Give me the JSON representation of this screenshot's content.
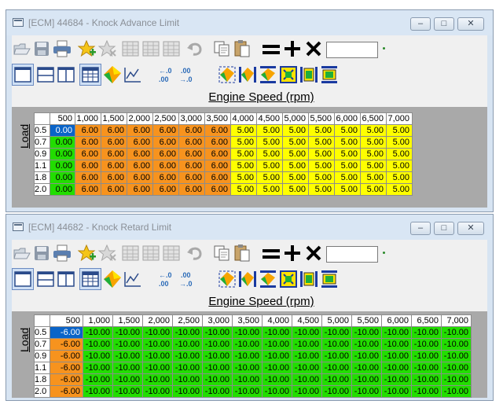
{
  "colors": {
    "orange": "#f7931e",
    "yellow": "#ffff00",
    "green": "#22dd00",
    "selected": "#0a64c8",
    "empty": "#a9a9a9"
  },
  "toolbar_icons": {
    "row1": [
      "open-folder-icon",
      "save-icon",
      "print-icon",
      "add-favorite-icon",
      "remove-favorite-icon",
      "table-select-icon-1",
      "table-select-icon-2",
      "table-select-icon-3",
      "undo-icon",
      "copy-icon",
      "paste-icon",
      "equals-icon",
      "plus-icon",
      "multiply-icon"
    ],
    "row2": [
      "single-view-icon",
      "split-horizontal-icon",
      "split-vertical-icon",
      "table-view-icon",
      "3d-map-icon",
      "graph-icon",
      "decimal-decrease-icon",
      "decimal-increase-icon",
      "interpolate-icon-1",
      "interpolate-icon-2",
      "interpolate-icon-3",
      "interpolate-icon-4",
      "interpolate-icon-5",
      "interpolate-icon-6"
    ]
  },
  "windows": [
    {
      "title": "[ECM] 44684 - Knock Advance Limit",
      "axis_title": "Engine Speed (rpm)",
      "load_label": "Load",
      "columns": [
        "500",
        "1,000",
        "1,500",
        "2,000",
        "2,500",
        "3,000",
        "3,500",
        "4,000",
        "4,500",
        "5,000",
        "5,500",
        "6,000",
        "6,500",
        "7,000"
      ],
      "rows": [
        {
          "label": "0.5",
          "values": [
            "0.00",
            "6.00",
            "6.00",
            "6.00",
            "6.00",
            "6.00",
            "6.00",
            "5.00",
            "5.00",
            "5.00",
            "5.00",
            "5.00",
            "5.00",
            "5.00"
          ]
        },
        {
          "label": "0.7",
          "values": [
            "0.00",
            "6.00",
            "6.00",
            "6.00",
            "6.00",
            "6.00",
            "6.00",
            "5.00",
            "5.00",
            "5.00",
            "5.00",
            "5.00",
            "5.00",
            "5.00"
          ]
        },
        {
          "label": "0.9",
          "values": [
            "0.00",
            "6.00",
            "6.00",
            "6.00",
            "6.00",
            "6.00",
            "6.00",
            "5.00",
            "5.00",
            "5.00",
            "5.00",
            "5.00",
            "5.00",
            "5.00"
          ]
        },
        {
          "label": "1.1",
          "values": [
            "0.00",
            "6.00",
            "6.00",
            "6.00",
            "6.00",
            "6.00",
            "6.00",
            "5.00",
            "5.00",
            "5.00",
            "5.00",
            "5.00",
            "5.00",
            "5.00"
          ]
        },
        {
          "label": "1.8",
          "values": [
            "0.00",
            "6.00",
            "6.00",
            "6.00",
            "6.00",
            "6.00",
            "6.00",
            "5.00",
            "5.00",
            "5.00",
            "5.00",
            "5.00",
            "5.00",
            "5.00"
          ]
        },
        {
          "label": "2.0",
          "values": [
            "0.00",
            "6.00",
            "6.00",
            "6.00",
            "6.00",
            "6.00",
            "6.00",
            "5.00",
            "5.00",
            "5.00",
            "5.00",
            "5.00",
            "5.00",
            "5.00"
          ]
        }
      ]
    },
    {
      "title": "[ECM] 44682 - Knock Retard Limit",
      "axis_title": "Engine Speed (rpm)",
      "load_label": "Load",
      "columns": [
        "500",
        "1,000",
        "1,500",
        "2,000",
        "2,500",
        "3,000",
        "3,500",
        "4,000",
        "4,500",
        "5,000",
        "5,500",
        "6,000",
        "6,500",
        "7,000"
      ],
      "rows": [
        {
          "label": "0.5",
          "values": [
            "-6.00",
            "-10.00",
            "-10.00",
            "-10.00",
            "-10.00",
            "-10.00",
            "-10.00",
            "-10.00",
            "-10.00",
            "-10.00",
            "-10.00",
            "-10.00",
            "-10.00",
            "-10.00"
          ]
        },
        {
          "label": "0.7",
          "values": [
            "-6.00",
            "-10.00",
            "-10.00",
            "-10.00",
            "-10.00",
            "-10.00",
            "-10.00",
            "-10.00",
            "-10.00",
            "-10.00",
            "-10.00",
            "-10.00",
            "-10.00",
            "-10.00"
          ]
        },
        {
          "label": "0.9",
          "values": [
            "-6.00",
            "-10.00",
            "-10.00",
            "-10.00",
            "-10.00",
            "-10.00",
            "-10.00",
            "-10.00",
            "-10.00",
            "-10.00",
            "-10.00",
            "-10.00",
            "-10.00",
            "-10.00"
          ]
        },
        {
          "label": "1.1",
          "values": [
            "-6.00",
            "-10.00",
            "-10.00",
            "-10.00",
            "-10.00",
            "-10.00",
            "-10.00",
            "-10.00",
            "-10.00",
            "-10.00",
            "-10.00",
            "-10.00",
            "-10.00",
            "-10.00"
          ]
        },
        {
          "label": "1.8",
          "values": [
            "-6.00",
            "-10.00",
            "-10.00",
            "-10.00",
            "-10.00",
            "-10.00",
            "-10.00",
            "-10.00",
            "-10.00",
            "-10.00",
            "-10.00",
            "-10.00",
            "-10.00",
            "-10.00"
          ]
        },
        {
          "label": "2.0",
          "values": [
            "-6.00",
            "-10.00",
            "-10.00",
            "-10.00",
            "-10.00",
            "-10.00",
            "-10.00",
            "-10.00",
            "-10.00",
            "-10.00",
            "-10.00",
            "-10.00",
            "-10.00",
            "-10.00"
          ]
        }
      ]
    }
  ]
}
